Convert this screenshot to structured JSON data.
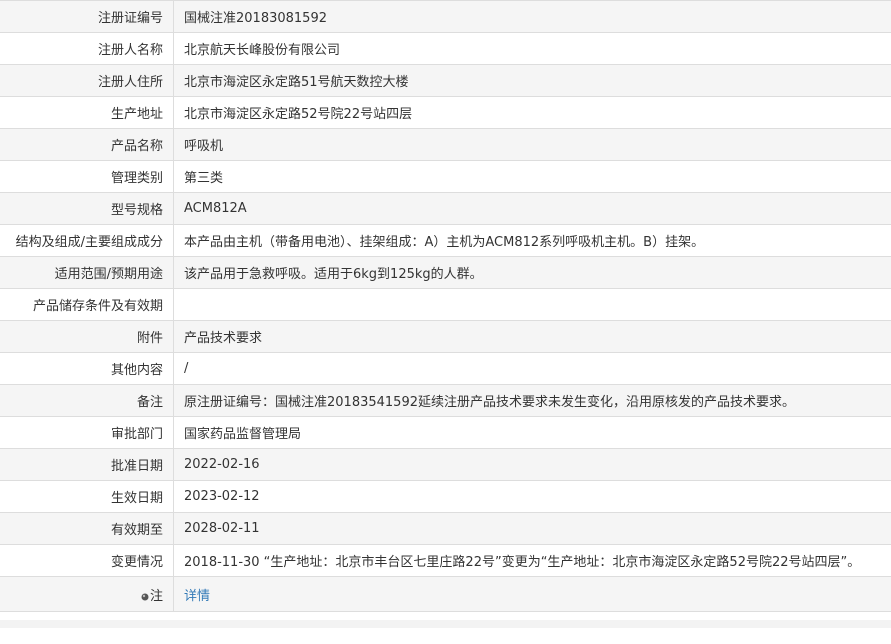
{
  "rows": [
    {
      "label": "注册证编号",
      "value": "国械注准20183081592"
    },
    {
      "label": "注册人名称",
      "value": "北京航天长峰股份有限公司"
    },
    {
      "label": "注册人住所",
      "value": "北京市海淀区永定路51号航天数控大楼"
    },
    {
      "label": "生产地址",
      "value": "北京市海淀区永定路52号院22号站四层"
    },
    {
      "label": "产品名称",
      "value": "呼吸机"
    },
    {
      "label": "管理类别",
      "value": "第三类"
    },
    {
      "label": "型号规格",
      "value": "ACM812A"
    },
    {
      "label": "结构及组成/主要组成成分",
      "value": "本产品由主机（带备用电池）、挂架组成：A）主机为ACM812系列呼吸机主机。B）挂架。"
    },
    {
      "label": "适用范围/预期用途",
      "value": "该产品用于急救呼吸。适用于6kg到125kg的人群。"
    },
    {
      "label": "产品储存条件及有效期",
      "value": ""
    },
    {
      "label": "附件",
      "value": "产品技术要求"
    },
    {
      "label": "其他内容",
      "value": "/"
    },
    {
      "label": "备注",
      "value": "原注册证编号：国械注准20183541592延续注册产品技术要求未发生变化，沿用原核发的产品技术要求。"
    },
    {
      "label": "审批部门",
      "value": "国家药品监督管理局"
    },
    {
      "label": "批准日期",
      "value": "2022-02-16"
    },
    {
      "label": "生效日期",
      "value": "2023-02-12"
    },
    {
      "label": "有效期至",
      "value": "2028-02-11"
    },
    {
      "label": "变更情况",
      "value": "2018-11-30 “生产地址：北京市丰台区七里庄路22号”变更为“生产地址：北京市海淀区永定路52号院22号站四层”。"
    }
  ],
  "note_row": {
    "label": "注",
    "link": "详情",
    "icon": "pin-icon"
  }
}
